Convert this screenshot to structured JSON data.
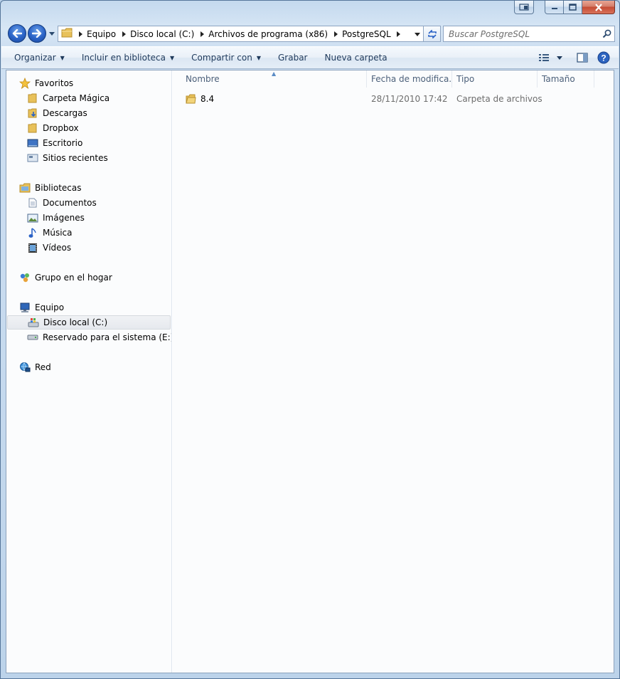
{
  "window": {
    "caption_buttons": [
      "minimize",
      "maximize",
      "close"
    ]
  },
  "address_bar": {
    "breadcrumbs": [
      "Equipo",
      "Disco local (C:)",
      "Archivos de programa (x86)",
      "PostgreSQL"
    ]
  },
  "search": {
    "placeholder": "Buscar PostgreSQL"
  },
  "toolbar": {
    "organize": "Organizar",
    "include_library": "Incluir en biblioteca",
    "share_with": "Compartir con",
    "burn": "Grabar",
    "new_folder": "Nueva carpeta"
  },
  "nav": {
    "favorites": {
      "label": "Favoritos",
      "items": [
        "Carpeta Mágica",
        "Descargas",
        "Dropbox",
        "Escritorio",
        "Sitios recientes"
      ]
    },
    "libraries": {
      "label": "Bibliotecas",
      "items": [
        "Documentos",
        "Imágenes",
        "Música",
        "Vídeos"
      ]
    },
    "homegroup": {
      "label": "Grupo en el hogar"
    },
    "computer": {
      "label": "Equipo",
      "items": [
        "Disco local (C:)",
        "Reservado para el sistema (E:)"
      ],
      "selected": "Disco local (C:)"
    },
    "network": {
      "label": "Red"
    }
  },
  "columns": [
    "Nombre",
    "Fecha de modifica...",
    "Tipo",
    "Tamaño"
  ],
  "files": [
    {
      "name": "8.4",
      "modified": "28/11/2010 17:42",
      "type": "Carpeta de archivos",
      "size": ""
    }
  ],
  "colors": {
    "accent": "#1e395b",
    "selection": "#e6e9ee",
    "folder": "#e8c15a"
  }
}
